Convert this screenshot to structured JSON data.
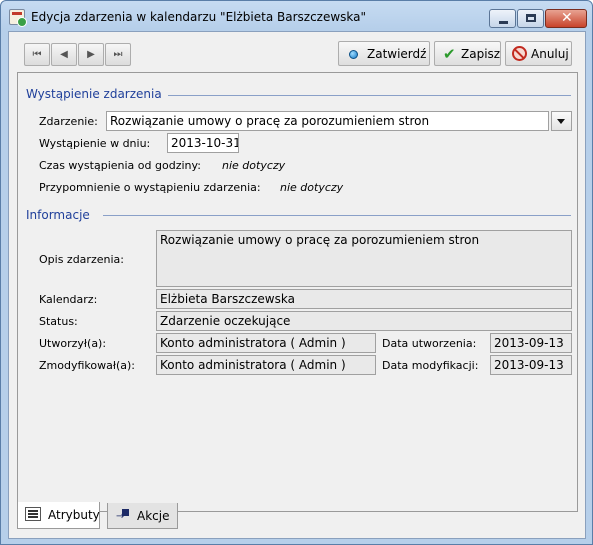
{
  "window": {
    "title": "Edycja zdarzenia w kalendarzu \"Elżbieta Barszczewska\"",
    "controls": {
      "minimize_icon": "minimize-icon",
      "maximize_icon": "maximize-icon",
      "close_glyph": "✕"
    }
  },
  "toolbar": {
    "nav": {
      "first": "⏮",
      "prev": "◀",
      "next": "▶",
      "last": "⏭"
    },
    "confirm_label": "Zatwierdź",
    "save_label": "Zapisz",
    "cancel_label": "Anuluj"
  },
  "section_occurrence": {
    "title": "Wystąpienie zdarzenia",
    "event_label": "Zdarzenie:",
    "event_value": "Rozwiązanie umowy o pracę za porozumieniem stron",
    "date_label": "Wystąpienie w dniu:",
    "date_value": "2013-10-31",
    "time_label": "Czas wystąpienia od godziny:",
    "time_value": "nie dotyczy",
    "reminder_label": "Przypomnienie o wystąpieniu zdarzenia:",
    "reminder_value": "nie dotyczy"
  },
  "section_info": {
    "title": "Informacje",
    "description_label": "Opis zdarzenia:",
    "description_value": "Rozwiązanie umowy o pracę za porozumieniem stron",
    "calendar_label": "Kalendarz:",
    "calendar_value": "Elżbieta Barszczewska",
    "status_label": "Status:",
    "status_value": "Zdarzenie oczekujące",
    "created_by_label": "Utworzył(a):",
    "created_by_value": "Konto administratora ( Admin )",
    "created_date_label": "Data utworzenia:",
    "created_date_value": "2013-09-13",
    "modified_by_label": "Zmodyfikował(a):",
    "modified_by_value": "Konto administratora ( Admin )",
    "modified_date_label": "Data modyfikacji:",
    "modified_date_value": "2013-09-13"
  },
  "tabs": [
    {
      "label": "Atrybuty",
      "active": true
    },
    {
      "label": "Akcje",
      "active": false
    }
  ]
}
